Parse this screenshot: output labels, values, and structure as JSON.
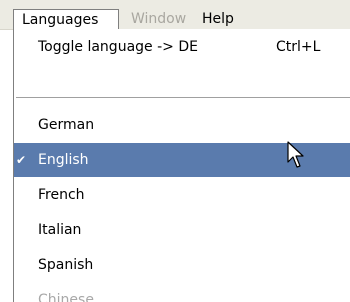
{
  "menubar": {
    "items": [
      {
        "label": "Languages",
        "state": "open"
      },
      {
        "label": "Window",
        "state": "disabled"
      },
      {
        "label": "Help",
        "state": "enabled"
      }
    ]
  },
  "menu": {
    "toggle": {
      "label": "Toggle language -> DE",
      "shortcut": "Ctrl+L"
    },
    "languages": [
      {
        "label": "German",
        "checked": false,
        "enabled": true
      },
      {
        "label": "English",
        "checked": true,
        "enabled": true,
        "highlighted": true
      },
      {
        "label": "French",
        "checked": false,
        "enabled": true
      },
      {
        "label": "Italian",
        "checked": false,
        "enabled": true
      },
      {
        "label": "Spanish",
        "checked": false,
        "enabled": true
      },
      {
        "label": "Chinese",
        "checked": false,
        "enabled": false
      }
    ],
    "check_glyph": "✔"
  },
  "icons": {
    "check": "checkmark-icon",
    "cursor": "mouse-pointer-icon"
  },
  "colors": {
    "highlight": "#5a7bad",
    "menubar_bg": "#ecebe3",
    "disabled_text": "#a8a8a8"
  }
}
